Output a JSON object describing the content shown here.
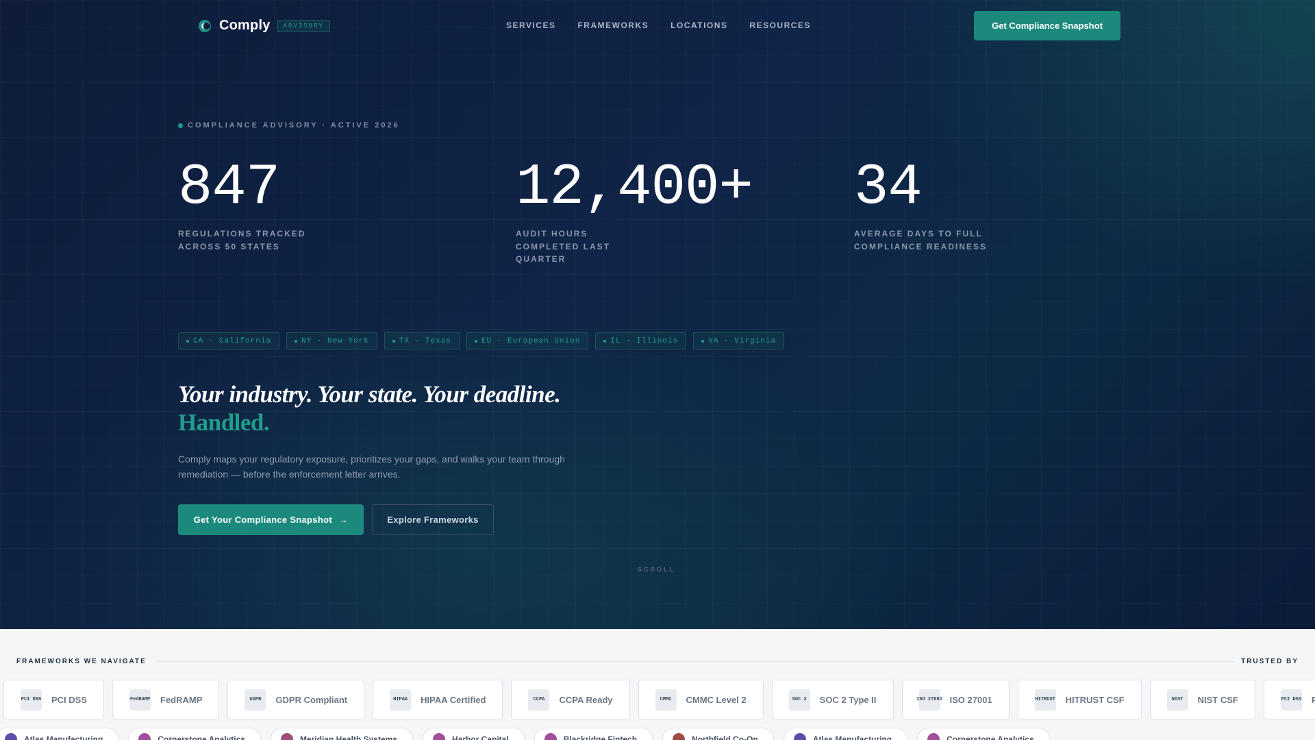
{
  "nav": {
    "brand": "Comply",
    "badge": "ADVISORY",
    "menu": [
      "SERVICES",
      "FRAMEWORKS",
      "LOCATIONS",
      "RESOURCES"
    ],
    "cta": "Get Compliance Snapshot"
  },
  "hero": {
    "eyebrow": "COMPLIANCE ADVISORY · ACTIVE 2026",
    "stats": [
      {
        "value": "847",
        "label_lines": [
          "REGULATIONS TRACKED",
          "ACROSS 50 STATES"
        ]
      },
      {
        "value": "12,400+",
        "label_lines": [
          "AUDIT HOURS",
          "COMPLETED LAST",
          "QUARTER"
        ]
      },
      {
        "value": "34",
        "label_lines": [
          "AVERAGE DAYS TO FULL",
          "COMPLIANCE READINESS"
        ]
      }
    ],
    "chips": [
      "CA · California",
      "NY · New York",
      "TX · Texas",
      "EU · European Union",
      "IL · Illinois",
      "VA · Virginia"
    ],
    "headline": "Your industry. Your state. Your deadline.",
    "headline_accent": "Handled.",
    "subtext": "Comply maps your regulatory exposure, prioritizes your gaps, and walks your team through remediation — before the enforcement letter arrives.",
    "primary_cta": "Get Your Compliance Snapshot",
    "primary_cta_arrow": "→",
    "secondary_cta": "Explore Frameworks",
    "scroll": "SCROLL"
  },
  "frameworks": {
    "label": "FRAMEWORKS WE NAVIGATE",
    "trusted_label": "TRUSTED BY",
    "items": [
      {
        "icon": "PCI DSS",
        "name": "PCI DSS"
      },
      {
        "icon": "FedRAMP",
        "name": "FedRAMP"
      },
      {
        "icon": "GDPR",
        "name": "GDPR Compliant"
      },
      {
        "icon": "HIPAA",
        "name": "HIPAA Certified"
      },
      {
        "icon": "CCPA",
        "name": "CCPA Ready"
      },
      {
        "icon": "CMMC",
        "name": "CMMC Level 2"
      },
      {
        "icon": "SOC 2",
        "name": "SOC 2 Type II"
      },
      {
        "icon": "ISO 27001",
        "name": "ISO 27001"
      },
      {
        "icon": "HITRUST",
        "name": "HITRUST CSF"
      },
      {
        "icon": "NIST",
        "name": "NIST CSF"
      },
      {
        "icon": "PCI DSS",
        "name": "PCI DSS"
      }
    ]
  },
  "clients": [
    {
      "name": "Atlas Manufacturing",
      "color": "#5b4ea8"
    },
    {
      "name": "Cornerstone Analytics",
      "color": "#a0509a"
    },
    {
      "name": "Meridian Health Systems",
      "color": "#a04f7a"
    },
    {
      "name": "Harbor Capital",
      "color": "#a0509a"
    },
    {
      "name": "Blackridge Fintech",
      "color": "#a0509a"
    },
    {
      "name": "Northfield Co-Op",
      "color": "#a04a4a"
    },
    {
      "name": "Atlas Manufacturing",
      "color": "#5b4ea8"
    },
    {
      "name": "Cornerstone Analytics",
      "color": "#a0509a"
    }
  ],
  "colors": {
    "accent": "#1b8a7c",
    "accent_text": "#1f9e8c",
    "hero_bg": "#0f2447"
  }
}
